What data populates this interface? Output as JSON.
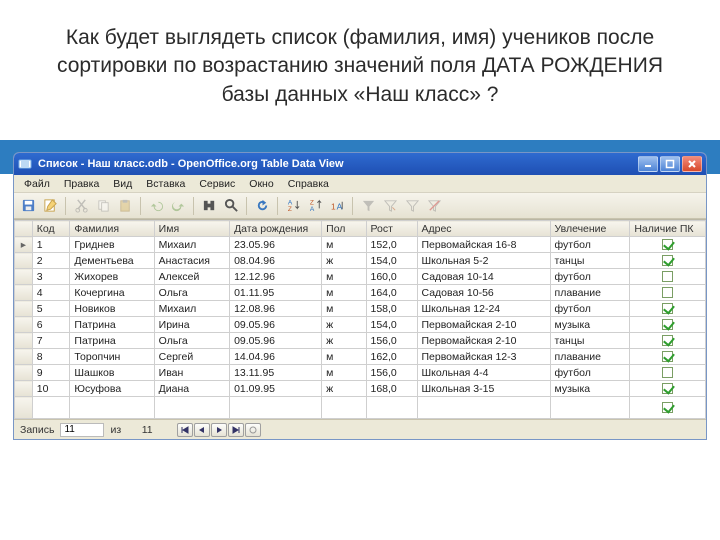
{
  "question": "Как будет выглядеть список (фамилия, имя) учеников после сортировки по возрастанию значений поля ДАТА РОЖДЕНИЯ базы данных «Наш класс» ?",
  "window": {
    "title": "Список - Наш класс.odb - OpenOffice.org Table Data View",
    "menus": [
      "Файл",
      "Правка",
      "Вид",
      "Вставка",
      "Сервис",
      "Окно",
      "Справка"
    ]
  },
  "columns": [
    "Код",
    "Фамилия",
    "Имя",
    "Дата рождения",
    "Пол",
    "Рост",
    "Адрес",
    "Увлечение",
    "Наличие ПК"
  ],
  "rows": [
    {
      "kod": "1",
      "fam": "Гриднев",
      "name": "Михаил",
      "date": "23.05.96",
      "pol": "м",
      "rost": "152,0",
      "adr": "Первомайская 16-8",
      "hob": "футбол",
      "pc": true
    },
    {
      "kod": "2",
      "fam": "Дементьева",
      "name": "Анастасия",
      "date": "08.04.96",
      "pol": "ж",
      "rost": "154,0",
      "adr": "Школьная 5-2",
      "hob": "танцы",
      "pc": true
    },
    {
      "kod": "3",
      "fam": "Жихорев",
      "name": "Алексей",
      "date": "12.12.96",
      "pol": "м",
      "rost": "160,0",
      "adr": "Садовая 10-14",
      "hob": "футбол",
      "pc": false
    },
    {
      "kod": "4",
      "fam": "Кочергина",
      "name": "Ольга",
      "date": "01.11.95",
      "pol": "м",
      "rost": "164,0",
      "adr": "Садовая 10-56",
      "hob": "плавание",
      "pc": false
    },
    {
      "kod": "5",
      "fam": "Новиков",
      "name": "Михаил",
      "date": "12.08.96",
      "pol": "м",
      "rost": "158,0",
      "adr": "Школьная 12-24",
      "hob": "футбол",
      "pc": true
    },
    {
      "kod": "6",
      "fam": "Патрина",
      "name": "Ирина",
      "date": "09.05.96",
      "pol": "ж",
      "rost": "154,0",
      "adr": "Первомайская 2-10",
      "hob": "музыка",
      "pc": true
    },
    {
      "kod": "7",
      "fam": "Патрина",
      "name": "Ольга",
      "date": "09.05.96",
      "pol": "ж",
      "rost": "156,0",
      "adr": "Первомайская 2-10",
      "hob": "танцы",
      "pc": true
    },
    {
      "kod": "8",
      "fam": "Торопчин",
      "name": "Сергей",
      "date": "14.04.96",
      "pol": "м",
      "rost": "162,0",
      "adr": "Первомайская 12-3",
      "hob": "плавание",
      "pc": true
    },
    {
      "kod": "9",
      "fam": "Шашков",
      "name": "Иван",
      "date": "13.11.95",
      "pol": "м",
      "rost": "156,0",
      "adr": "Школьная 4-4",
      "hob": "футбол",
      "pc": false
    },
    {
      "kod": "10",
      "fam": "Юсуфова",
      "name": "Диана",
      "date": "01.09.95",
      "pol": "ж",
      "rost": "168,0",
      "adr": "Школьная 3-15",
      "hob": "музыка",
      "pc": true
    }
  ],
  "status": {
    "label": "Запись",
    "current": "11",
    "of": "из",
    "total": "11"
  }
}
